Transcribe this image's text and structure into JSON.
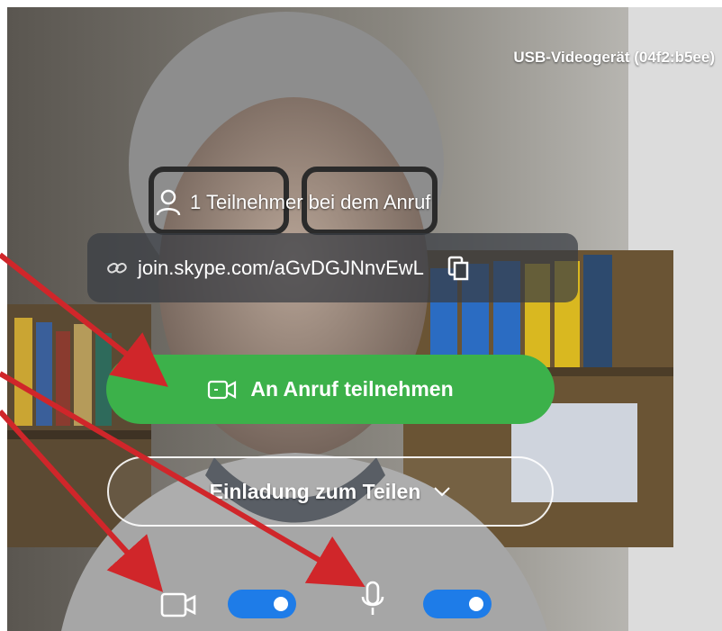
{
  "device_label": "USB-Videogerät (04f2:b5ee)",
  "participants": {
    "text": "1 Teilnehmer bei dem Anruf",
    "icon": "person-icon"
  },
  "link": {
    "text": "join.skype.com/aGvDGJNnvEwL",
    "icon": "link-icon",
    "copy_icon": "copy-icon"
  },
  "join_button": {
    "label": "An Anruf teilnehmen",
    "icon": "camera-icon",
    "color": "#3cb14a"
  },
  "invite_button": {
    "label": "Einladung zum Teilen",
    "icon": "chevron-down-icon"
  },
  "controls": {
    "camera": {
      "icon": "camera-icon",
      "enabled": true
    },
    "microphone": {
      "icon": "microphone-icon",
      "enabled": true
    },
    "toggle_color": "#1e7ce8"
  },
  "annotation_color": "#d0262a"
}
